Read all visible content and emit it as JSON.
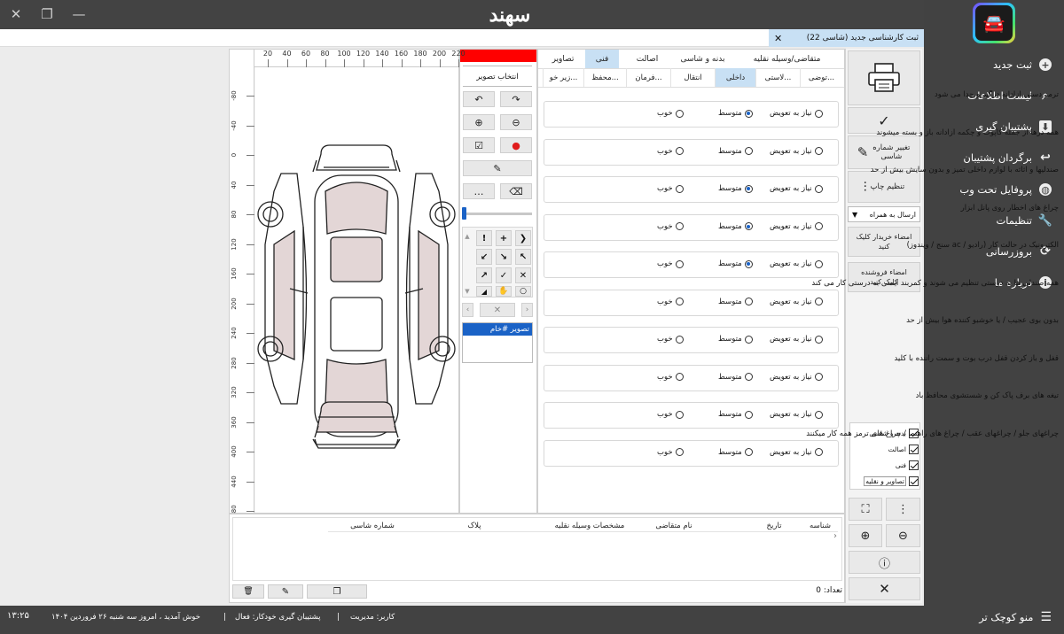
{
  "app": {
    "brand": "سهند"
  },
  "window": {
    "controls": [
      "close",
      "maximize",
      "minimize"
    ]
  },
  "sidebar": {
    "items": [
      {
        "label": "ثبت جدید",
        "icon": "plus-icon"
      },
      {
        "label": "لیست اطلاعات",
        "icon": "search-icon"
      },
      {
        "label": "پشتیبان گیری",
        "icon": "download-icon"
      },
      {
        "label": "برگردان پشتیبان",
        "icon": "undo-icon"
      },
      {
        "label": "پروفایل تحت وب",
        "icon": "globe-icon"
      },
      {
        "label": "تنظیمات",
        "icon": "wrench-icon"
      },
      {
        "label": "بروزرسانی",
        "icon": "refresh-icon"
      },
      {
        "label": "درباره ما",
        "icon": "info-icon"
      }
    ],
    "collapse_label": "منو کوچک تر"
  },
  "doc_tab": {
    "title": "ثبت کارشناسی جدید (شاسی 22)"
  },
  "tabs_row1": [
    "متقاضی/وسیله نقلیه",
    "بدنه و شاسی",
    "اصالت",
    "فنی",
    "تصاویر"
  ],
  "tabs_row2": [
    "توضی...",
    "لاستی...",
    "داخلی",
    "انتقال",
    "فرمان...",
    "محفظ...",
    "زیر خو..."
  ],
  "options": {
    "need_replace": "نیاز به تعویض",
    "medium": "متوسط",
    "good": "خوب"
  },
  "questions": [
    {
      "text": "ترمز دستی آزادانه درگیر و جدا می شود",
      "selected": "medium"
    },
    {
      "text": "همه درها از جمله کاپوت و چکمه آزادانه باز و بسته میشوند",
      "selected": "none"
    },
    {
      "text": "صندلیها و اثاثه با لوازم داخلی تمیز و بدون سایش بیش از حد",
      "selected": "medium"
    },
    {
      "text": "چراغ های اخطار روی پانل ابزار",
      "selected": "medium"
    },
    {
      "text": "الکترونیک در حالت کار (رادیو / ac سنج / ویندوز)",
      "selected": "medium"
    },
    {
      "text": "همه صندلی ها به درستی تنظیم می شوند و کمربند ایمنی به درستی کار می کند",
      "selected": "none"
    },
    {
      "text": "بدون بوی عجیب / یا خوشبو کننده هوا بیش از حد",
      "selected": "none"
    },
    {
      "text": "قفل و باز کردن قفل درب بوت و سمت راننده با کلید",
      "selected": "none"
    },
    {
      "text": "تیغه های برف پاک کن و شستشوی محافظ باد",
      "selected": "none"
    },
    {
      "text": "چراغهای جلو / چراغهای عقب / چراغ های راهنما / چراغ های ترمز همه کار میکنند",
      "selected": "none"
    }
  ],
  "right_panel": {
    "change_chassis": "تغییر شماره شاسی",
    "print_settings": "تنظیم چاپ",
    "send_with": "ارسال به همراه",
    "buyer_sign": "امضاء خریدار کلیک کنید",
    "seller_sign": "امضاء فروشنده کلیک کنید",
    "checks": [
      "بدنه و شاسی",
      "اصالت",
      "فنی",
      "تصاویر و نقلیه"
    ]
  },
  "tools": {
    "select_image": "انتخاب تصویر",
    "image_item": "تصویر #خام",
    "color": "#ff0000"
  },
  "ruler": {
    "top": [
      "20",
      "40",
      "60",
      "80",
      "100",
      "120",
      "140",
      "160",
      "180",
      "200",
      "220"
    ],
    "left": [
      "-80",
      "-40",
      "0",
      "40",
      "80",
      "120",
      "160",
      "200",
      "240",
      "280",
      "320",
      "360",
      "400",
      "440",
      "480"
    ]
  },
  "table": {
    "headers": [
      "شناسه",
      "تاریخ",
      "نام متقاضی",
      "مشخصات وسیله نقلیه",
      "پلاک",
      "شماره شاسی"
    ],
    "count_label": "تعداد:",
    "count": "0"
  },
  "status": {
    "time": "۱۳:۲۵",
    "welcome": "خوش آمدید ، امروز سه شنبه ۲۶ فروردین ۱۴۰۴",
    "backup": "پشتیبان گیری خودکار: فعال",
    "user": "کاربر: مدیریت"
  }
}
